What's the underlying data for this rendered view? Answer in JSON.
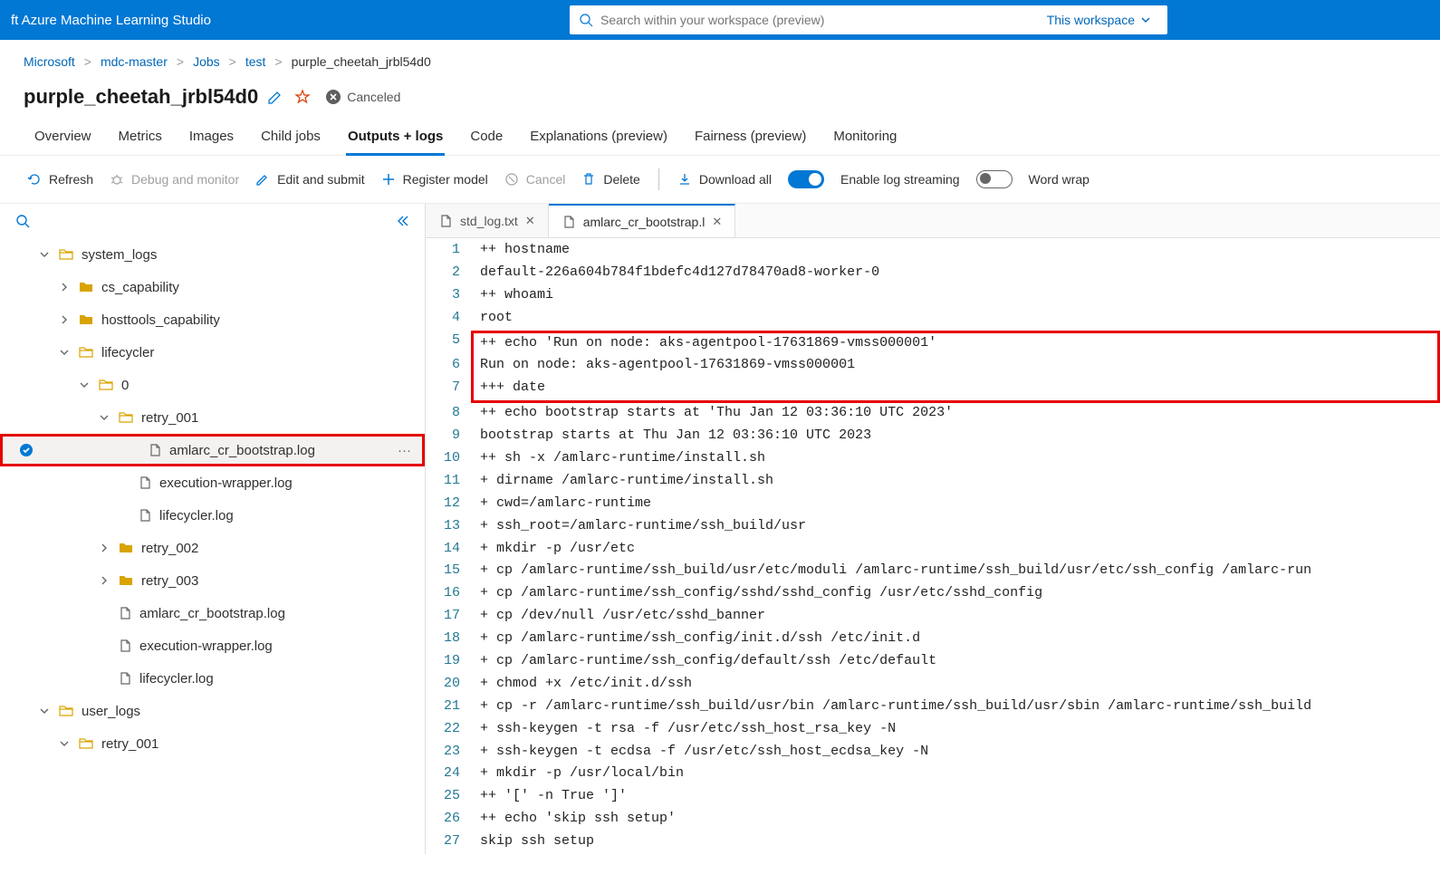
{
  "brand": "ft Azure Machine Learning Studio",
  "search": {
    "placeholder": "Search within your workspace (preview)",
    "scope": "This workspace"
  },
  "breadcrumb": [
    "Microsoft",
    "mdc-master",
    "Jobs",
    "test",
    "purple_cheetah_jrbl54d0"
  ],
  "title": "purple_cheetah_jrbl54d0",
  "status": "Canceled",
  "tabs": [
    "Overview",
    "Metrics",
    "Images",
    "Child jobs",
    "Outputs + logs",
    "Code",
    "Explanations (preview)",
    "Fairness (preview)",
    "Monitoring"
  ],
  "tabs_active_index": 4,
  "toolbar": {
    "refresh": "Refresh",
    "debug": "Debug and monitor",
    "edit": "Edit and submit",
    "register": "Register model",
    "cancel": "Cancel",
    "delete": "Delete",
    "download": "Download all",
    "streaming": "Enable log streaming",
    "wrap": "Word wrap"
  },
  "tree": [
    {
      "depth": 0,
      "kind": "folder-open",
      "chev": "down",
      "label": "system_logs"
    },
    {
      "depth": 1,
      "kind": "folder",
      "chev": "right",
      "label": "cs_capability"
    },
    {
      "depth": 1,
      "kind": "folder",
      "chev": "right",
      "label": "hosttools_capability"
    },
    {
      "depth": 1,
      "kind": "folder-open",
      "chev": "down",
      "label": "lifecycler"
    },
    {
      "depth": 2,
      "kind": "folder-open",
      "chev": "down",
      "label": "0"
    },
    {
      "depth": 3,
      "kind": "folder-open",
      "chev": "down",
      "label": "retry_001"
    },
    {
      "depth": 4,
      "kind": "file",
      "selected": true,
      "checked": true,
      "label": "amlarc_cr_bootstrap.log"
    },
    {
      "depth": 4,
      "kind": "file",
      "label": "execution-wrapper.log"
    },
    {
      "depth": 4,
      "kind": "file",
      "label": "lifecycler.log"
    },
    {
      "depth": 3,
      "kind": "folder",
      "chev": "right",
      "label": "retry_002"
    },
    {
      "depth": 3,
      "kind": "folder",
      "chev": "right",
      "label": "retry_003"
    },
    {
      "depth": 3,
      "kind": "file",
      "label": "amlarc_cr_bootstrap.log"
    },
    {
      "depth": 3,
      "kind": "file",
      "label": "execution-wrapper.log"
    },
    {
      "depth": 3,
      "kind": "file",
      "label": "lifecycler.log"
    },
    {
      "depth": 0,
      "kind": "folder-open",
      "chev": "down",
      "label": "user_logs"
    },
    {
      "depth": 1,
      "kind": "folder-open",
      "chev": "down",
      "label": "retry_001"
    }
  ],
  "editor_tabs": [
    {
      "label": "std_log.txt",
      "active": false
    },
    {
      "label": "amlarc_cr_bootstrap.l",
      "active": true
    }
  ],
  "code_highlight_rows": [
    5,
    6
  ],
  "code": [
    "++ hostname",
    "default-226a604b784f1bdefc4d127d78470ad8-worker-0",
    "++ whoami",
    "root",
    "++ echo 'Run on node: aks-agentpool-17631869-vmss000001'",
    "Run on node: aks-agentpool-17631869-vmss000001",
    "+++ date",
    "++ echo bootstrap starts at 'Thu Jan 12 03:36:10 UTC 2023'",
    "bootstrap starts at Thu Jan 12 03:36:10 UTC 2023",
    "++ sh -x /amlarc-runtime/install.sh",
    "+ dirname /amlarc-runtime/install.sh",
    "+ cwd=/amlarc-runtime",
    "+ ssh_root=/amlarc-runtime/ssh_build/usr",
    "+ mkdir -p /usr/etc",
    "+ cp /amlarc-runtime/ssh_build/usr/etc/moduli /amlarc-runtime/ssh_build/usr/etc/ssh_config /amlarc-run",
    "+ cp /amlarc-runtime/ssh_config/sshd/sshd_config /usr/etc/sshd_config",
    "+ cp /dev/null /usr/etc/sshd_banner",
    "+ cp /amlarc-runtime/ssh_config/init.d/ssh /etc/init.d",
    "+ cp /amlarc-runtime/ssh_config/default/ssh /etc/default",
    "+ chmod +x /etc/init.d/ssh",
    "+ cp -r /amlarc-runtime/ssh_build/usr/bin /amlarc-runtime/ssh_build/usr/sbin /amlarc-runtime/ssh_build",
    "+ ssh-keygen -t rsa -f /usr/etc/ssh_host_rsa_key -N",
    "+ ssh-keygen -t ecdsa -f /usr/etc/ssh_host_ecdsa_key -N",
    "+ mkdir -p /usr/local/bin",
    "++ '[' -n True ']'",
    "++ echo 'skip ssh setup'",
    "skip ssh setup"
  ]
}
